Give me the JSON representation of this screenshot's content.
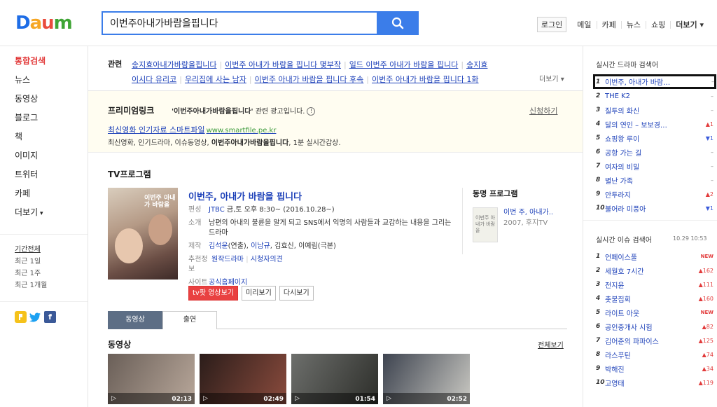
{
  "logo": {
    "d1": "D",
    "a": "a",
    "u": "u",
    "m": "m"
  },
  "search": {
    "query": "이번주아내가바람을핍니다"
  },
  "gnb": {
    "login": "로그인",
    "items": [
      "메일",
      "카페",
      "뉴스",
      "쇼핑"
    ],
    "more": "더보기"
  },
  "lnb": {
    "items": [
      "통합검색",
      "뉴스",
      "동영상",
      "블로그",
      "책",
      "이미지",
      "트위터",
      "카페",
      "더보기"
    ],
    "period": [
      "기간전체",
      "최근 1일",
      "최근 1주",
      "최근 1개월"
    ]
  },
  "related": {
    "label": "관련",
    "links": [
      "송지효아내가바람을핍니다",
      "이번주 아내가 바람을 핍니다 몇부작",
      "일드 이번주 아내가 바람을 핍니다",
      "송지효",
      "이시다 유리코",
      "우리집에 사는 남자",
      "이번주 아내가 바람을 핍니다 후속",
      "이번주 아내가 바람을 핍니다 1화"
    ],
    "more": "더보기"
  },
  "premium": {
    "title": "프리미엄링크",
    "desc_query": "'이번주아내가바람을핍니다'",
    "desc_rest": "관련 광고입니다.",
    "info": "!",
    "apply": "신청하기",
    "ad_title": "최신영화 인기자료 스마트파일",
    "ad_url": "www.smartfile.pe.kr",
    "ad_text_pre": "최신영화, 인기드라마, 이슈동영상, ",
    "ad_text_bold": "이번주아내가바람을핍니다",
    "ad_text_post": ", 1분 실시간감상."
  },
  "tv": {
    "section_title": "TV프로그램",
    "poster_text": "이번주 아내가 바람을",
    "title": "이번주, 아내가 바람을 핍니다",
    "rows": {
      "schedule_k": "편성",
      "schedule_net": "JTBC",
      "schedule_v": "금,토 오후 8:30~ (2016.10.28~)",
      "intro_k": "소개",
      "intro_v": "남편의 아내의 불륜을 알게 되고 SNS에서 익명의 사람들과 교감하는 내용을 그리는 드라마",
      "prod_k": "제작",
      "prod_a": "김석윤",
      "prod_b": "(연출), ",
      "prod_c": "이남규",
      "prod_d": ", 김효신, 이예림(극본)",
      "rec_k": "추천정보",
      "rec_a": "원작드라마",
      "rec_b": "시청자의견",
      "site_k": "사이트",
      "site_v": "공식홈페이지"
    },
    "buttons": {
      "tv": "tv팟 영상보기",
      "preview": "미리보기",
      "replay": "다시보기"
    },
    "same": {
      "title": "동명 프로그램",
      "thumb_text": "이번주 아내가 바람을",
      "name": "이번 주, 아내가..",
      "sub": "2007, 후지TV"
    }
  },
  "tabs": [
    "동영상",
    "출연"
  ],
  "videos": {
    "title": "동영상",
    "all": "전체보기",
    "items": [
      {
        "duration": "02:13",
        "c1": "#6a5f58",
        "c2": "#b8a79a"
      },
      {
        "duration": "02:49",
        "c1": "#2b1d1a",
        "c2": "#8a4b3d"
      },
      {
        "duration": "01:54",
        "c1": "#6d6f6c",
        "c2": "#2d2e2a"
      },
      {
        "duration": "02:52",
        "c1": "#3e4450",
        "c2": "#c9c8c2"
      }
    ],
    "play": "▷"
  },
  "side": {
    "drama_title": "실시간 드라마 검색어",
    "drama": [
      {
        "n": "1",
        "t": "이번주, 아내가 바람…",
        "c": "–",
        "cls": ""
      },
      {
        "n": "2",
        "t": "THE K2",
        "c": "–",
        "cls": ""
      },
      {
        "n": "3",
        "t": "질투의 화신",
        "c": "–",
        "cls": ""
      },
      {
        "n": "4",
        "t": "달의 연인 – 보보경…",
        "c": "▲1",
        "cls": "up"
      },
      {
        "n": "5",
        "t": "쇼핑왕 루이",
        "c": "▼1",
        "cls": "dn"
      },
      {
        "n": "6",
        "t": "공항 가는 길",
        "c": "–",
        "cls": ""
      },
      {
        "n": "7",
        "t": "여자의 비밀",
        "c": "–",
        "cls": ""
      },
      {
        "n": "8",
        "t": "별난 가족",
        "c": "–",
        "cls": ""
      },
      {
        "n": "9",
        "t": "안투라지",
        "c": "▲2",
        "cls": "up"
      },
      {
        "n": "10",
        "t": "불어라 미풍아",
        "c": "▼1",
        "cls": "dn"
      }
    ],
    "issue_title": "실시간 이슈 검색어",
    "time": "10.29  10:53",
    "issue": [
      {
        "n": "1",
        "t": "언페이스풀",
        "c": "NEW",
        "cls": "new"
      },
      {
        "n": "2",
        "t": "세월호 7시간",
        "c": "▲162",
        "cls": "up"
      },
      {
        "n": "3",
        "t": "전지윤",
        "c": "▲111",
        "cls": "up"
      },
      {
        "n": "4",
        "t": "촛불집회",
        "c": "▲160",
        "cls": "up"
      },
      {
        "n": "5",
        "t": "라이트 아웃",
        "c": "NEW",
        "cls": "new"
      },
      {
        "n": "6",
        "t": "공인중개사 시험",
        "c": "▲82",
        "cls": "up"
      },
      {
        "n": "7",
        "t": "김어준의 파파이스",
        "c": "▲125",
        "cls": "up"
      },
      {
        "n": "8",
        "t": "라스푸틴",
        "c": "▲74",
        "cls": "up"
      },
      {
        "n": "9",
        "t": "박해진",
        "c": "▲34",
        "cls": "up"
      },
      {
        "n": "10",
        "t": "고영태",
        "c": "▲119",
        "cls": "up"
      }
    ]
  }
}
